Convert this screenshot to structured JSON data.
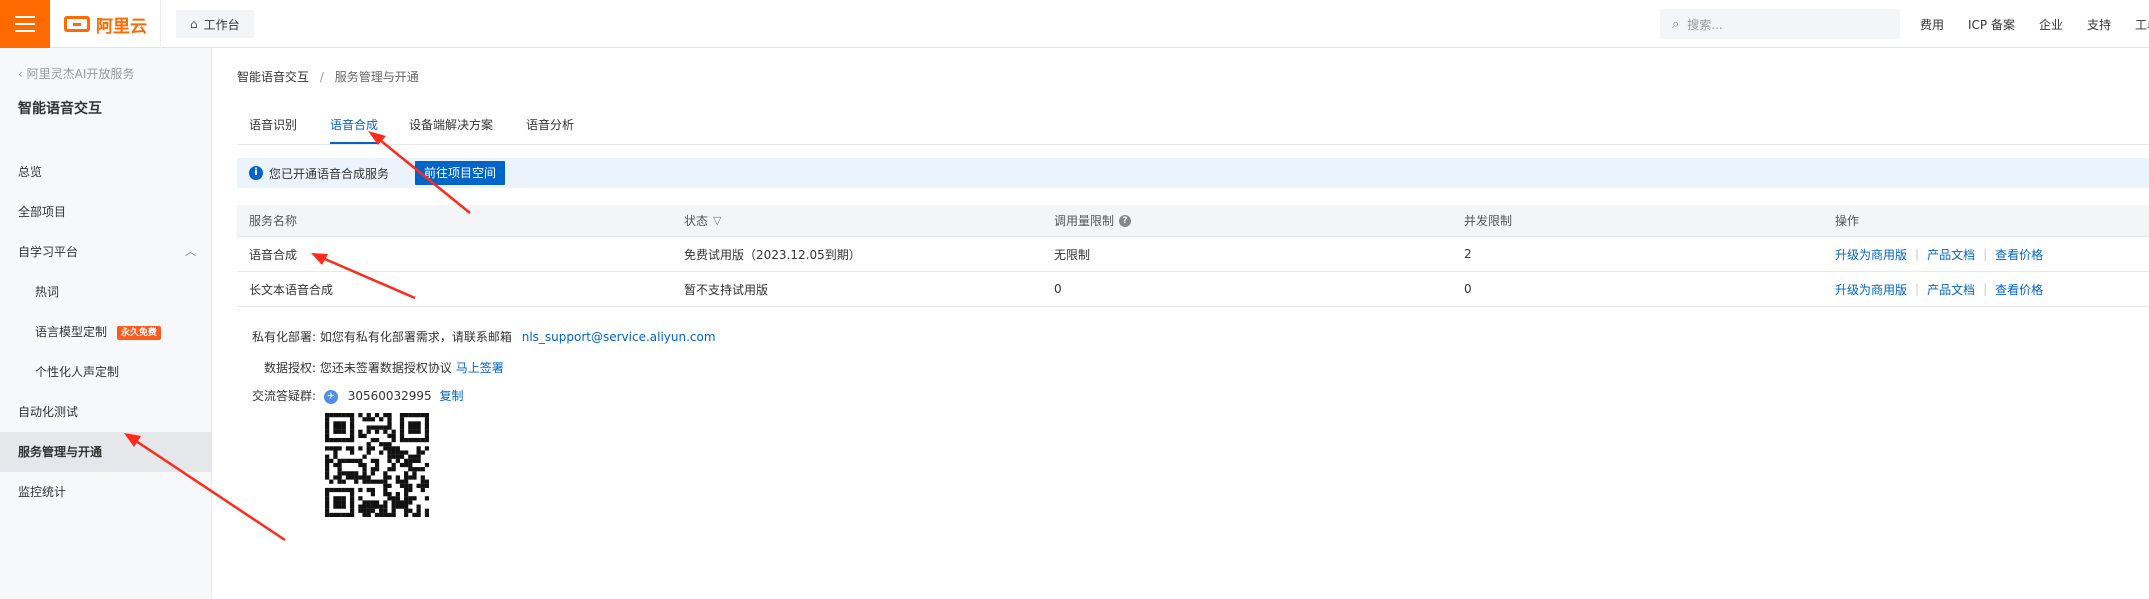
{
  "topbar": {
    "logo_text": "阿里云",
    "workbench_label": "工作台",
    "search_placeholder": "搜索...",
    "links": [
      "费用",
      "ICP 备案",
      "企业",
      "支持",
      "工单"
    ]
  },
  "sidebar": {
    "back_label": "阿里灵杰AI开放服务",
    "title": "智能语音交互",
    "items": [
      {
        "label": "总览"
      },
      {
        "label": "全部项目"
      },
      {
        "label": "自学习平台"
      },
      {
        "label": "热词"
      },
      {
        "label": "语言模型定制",
        "badge": "永久免费"
      },
      {
        "label": "个性化人声定制"
      },
      {
        "label": "自动化测试"
      },
      {
        "label": "服务管理与开通"
      },
      {
        "label": "监控统计"
      }
    ]
  },
  "breadcrumb": {
    "root": "智能语音交互",
    "separator": "/",
    "current": "服务管理与开通"
  },
  "tabs": [
    "语音识别",
    "语音合成",
    "设备端解决方案",
    "语音分析"
  ],
  "active_tab": "语音合成",
  "notice": {
    "text": "您已开通语音合成服务",
    "button": "前往项目空间"
  },
  "table": {
    "headers": [
      "服务名称",
      "状态",
      "调用量限制",
      "并发限制",
      "操作"
    ],
    "rows": [
      {
        "name": "语音合成",
        "status": "免费试用版（2023.12.05到期）",
        "call_limit": "无限制",
        "concurrency": "2"
      },
      {
        "name": "长文本语音合成",
        "status": "暂不支持试用版",
        "call_limit": "0",
        "concurrency": "0"
      }
    ],
    "actions": [
      "升级为商用版",
      "产品文档",
      "查看价格"
    ],
    "action_separator": "|"
  },
  "info": {
    "private_label": "私有化部署:",
    "private_text": "如您有私有化部署需求，请联系邮箱",
    "private_email": "nls_support@service.aliyun.com",
    "auth_label": "数据授权:",
    "auth_text": "您还未签署数据授权协议",
    "auth_link": "马上签署",
    "group_label": "交流答疑群:",
    "group_number": "30560032995",
    "group_copy": "复制"
  },
  "colors": {
    "brand": "#ff6a00",
    "link": "#0064c8",
    "annotation_arrow": "#ff2a1a",
    "notice_bg": "#ebf4fd"
  }
}
